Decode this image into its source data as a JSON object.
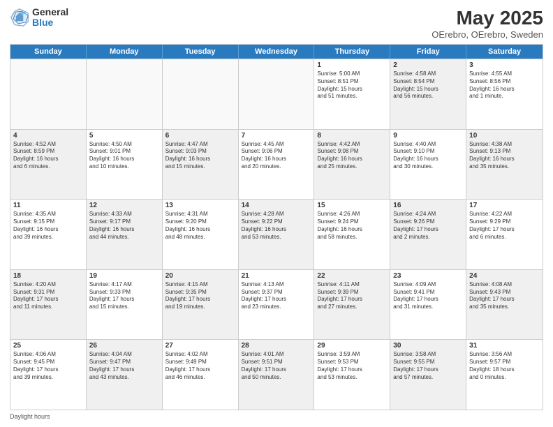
{
  "header": {
    "logo_general": "General",
    "logo_blue": "Blue",
    "title": "May 2025",
    "subtitle": "OErebro, OErebro, Sweden"
  },
  "days_of_week": [
    "Sunday",
    "Monday",
    "Tuesday",
    "Wednesday",
    "Thursday",
    "Friday",
    "Saturday"
  ],
  "footer": "Daylight hours",
  "rows": [
    [
      {
        "day": "",
        "text": "",
        "empty": true
      },
      {
        "day": "",
        "text": "",
        "empty": true
      },
      {
        "day": "",
        "text": "",
        "empty": true
      },
      {
        "day": "",
        "text": "",
        "empty": true
      },
      {
        "day": "1",
        "text": "Sunrise: 5:00 AM\nSunset: 8:51 PM\nDaylight: 15 hours\nand 51 minutes."
      },
      {
        "day": "2",
        "text": "Sunrise: 4:58 AM\nSunset: 8:54 PM\nDaylight: 15 hours\nand 56 minutes.",
        "shaded": true
      },
      {
        "day": "3",
        "text": "Sunrise: 4:55 AM\nSunset: 8:56 PM\nDaylight: 16 hours\nand 1 minute."
      }
    ],
    [
      {
        "day": "4",
        "text": "Sunrise: 4:52 AM\nSunset: 8:59 PM\nDaylight: 16 hours\nand 6 minutes.",
        "shaded": true
      },
      {
        "day": "5",
        "text": "Sunrise: 4:50 AM\nSunset: 9:01 PM\nDaylight: 16 hours\nand 10 minutes."
      },
      {
        "day": "6",
        "text": "Sunrise: 4:47 AM\nSunset: 9:03 PM\nDaylight: 16 hours\nand 15 minutes.",
        "shaded": true
      },
      {
        "day": "7",
        "text": "Sunrise: 4:45 AM\nSunset: 9:06 PM\nDaylight: 16 hours\nand 20 minutes."
      },
      {
        "day": "8",
        "text": "Sunrise: 4:42 AM\nSunset: 9:08 PM\nDaylight: 16 hours\nand 25 minutes.",
        "shaded": true
      },
      {
        "day": "9",
        "text": "Sunrise: 4:40 AM\nSunset: 9:10 PM\nDaylight: 16 hours\nand 30 minutes."
      },
      {
        "day": "10",
        "text": "Sunrise: 4:38 AM\nSunset: 9:13 PM\nDaylight: 16 hours\nand 35 minutes.",
        "shaded": true
      }
    ],
    [
      {
        "day": "11",
        "text": "Sunrise: 4:35 AM\nSunset: 9:15 PM\nDaylight: 16 hours\nand 39 minutes."
      },
      {
        "day": "12",
        "text": "Sunrise: 4:33 AM\nSunset: 9:17 PM\nDaylight: 16 hours\nand 44 minutes.",
        "shaded": true
      },
      {
        "day": "13",
        "text": "Sunrise: 4:31 AM\nSunset: 9:20 PM\nDaylight: 16 hours\nand 48 minutes."
      },
      {
        "day": "14",
        "text": "Sunrise: 4:28 AM\nSunset: 9:22 PM\nDaylight: 16 hours\nand 53 minutes.",
        "shaded": true
      },
      {
        "day": "15",
        "text": "Sunrise: 4:26 AM\nSunset: 9:24 PM\nDaylight: 16 hours\nand 58 minutes."
      },
      {
        "day": "16",
        "text": "Sunrise: 4:24 AM\nSunset: 9:26 PM\nDaylight: 17 hours\nand 2 minutes.",
        "shaded": true
      },
      {
        "day": "17",
        "text": "Sunrise: 4:22 AM\nSunset: 9:29 PM\nDaylight: 17 hours\nand 6 minutes."
      }
    ],
    [
      {
        "day": "18",
        "text": "Sunrise: 4:20 AM\nSunset: 9:31 PM\nDaylight: 17 hours\nand 11 minutes.",
        "shaded": true
      },
      {
        "day": "19",
        "text": "Sunrise: 4:17 AM\nSunset: 9:33 PM\nDaylight: 17 hours\nand 15 minutes."
      },
      {
        "day": "20",
        "text": "Sunrise: 4:15 AM\nSunset: 9:35 PM\nDaylight: 17 hours\nand 19 minutes.",
        "shaded": true
      },
      {
        "day": "21",
        "text": "Sunrise: 4:13 AM\nSunset: 9:37 PM\nDaylight: 17 hours\nand 23 minutes."
      },
      {
        "day": "22",
        "text": "Sunrise: 4:11 AM\nSunset: 9:39 PM\nDaylight: 17 hours\nand 27 minutes.",
        "shaded": true
      },
      {
        "day": "23",
        "text": "Sunrise: 4:09 AM\nSunset: 9:41 PM\nDaylight: 17 hours\nand 31 minutes."
      },
      {
        "day": "24",
        "text": "Sunrise: 4:08 AM\nSunset: 9:43 PM\nDaylight: 17 hours\nand 35 minutes.",
        "shaded": true
      }
    ],
    [
      {
        "day": "25",
        "text": "Sunrise: 4:06 AM\nSunset: 9:45 PM\nDaylight: 17 hours\nand 39 minutes."
      },
      {
        "day": "26",
        "text": "Sunrise: 4:04 AM\nSunset: 9:47 PM\nDaylight: 17 hours\nand 43 minutes.",
        "shaded": true
      },
      {
        "day": "27",
        "text": "Sunrise: 4:02 AM\nSunset: 9:49 PM\nDaylight: 17 hours\nand 46 minutes."
      },
      {
        "day": "28",
        "text": "Sunrise: 4:01 AM\nSunset: 9:51 PM\nDaylight: 17 hours\nand 50 minutes.",
        "shaded": true
      },
      {
        "day": "29",
        "text": "Sunrise: 3:59 AM\nSunset: 9:53 PM\nDaylight: 17 hours\nand 53 minutes."
      },
      {
        "day": "30",
        "text": "Sunrise: 3:58 AM\nSunset: 9:55 PM\nDaylight: 17 hours\nand 57 minutes.",
        "shaded": true
      },
      {
        "day": "31",
        "text": "Sunrise: 3:56 AM\nSunset: 9:57 PM\nDaylight: 18 hours\nand 0 minutes."
      }
    ]
  ]
}
